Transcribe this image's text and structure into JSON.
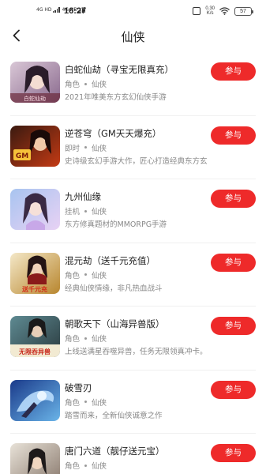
{
  "status_bar": {
    "signal1": "4G HD",
    "signal2": "4G HD",
    "time": "16:27",
    "net_speed_value": "0.30",
    "net_speed_unit": "K/s",
    "battery": "57"
  },
  "header": {
    "title": "仙侠",
    "back_icon": "chevron-left-icon"
  },
  "colors": {
    "accent": "#ee2a2a",
    "text_primary": "#222222",
    "text_secondary": "#888888"
  },
  "games": [
    {
      "name": "白蛇仙劫（寻宝无限真充）",
      "type": "角色",
      "genre": "仙侠",
      "desc": "2021年唯美东方玄幻仙侠手游",
      "button": "参与"
    },
    {
      "name": "逆苍穹（GM天天爆充）",
      "type": "即时",
      "genre": "仙侠",
      "desc": "史诗级玄幻手游大作，匠心打造经典东方玄幻世界！",
      "button": "参与"
    },
    {
      "name": "九州仙缘",
      "type": "挂机",
      "genre": "仙侠",
      "desc": "东方修真题材的MMORPG手游",
      "button": "参与"
    },
    {
      "name": "混元劫（送千元充值）",
      "type": "角色",
      "genre": "仙侠",
      "desc": "经典仙侠情缘，非凡热血战斗",
      "button": "参与"
    },
    {
      "name": "朝歌天下（山海异兽版）",
      "type": "角色",
      "genre": "仙侠",
      "desc": "上线送满星吞噬异兽，任务无限领真冲卡。",
      "button": "参与"
    },
    {
      "name": "破雪刃",
      "type": "角色",
      "genre": "仙侠",
      "desc": "踏雪而来，全新仙侠诚意之作",
      "button": "参与"
    },
    {
      "name": "唐门六道（靓仔送元宝）",
      "type": "角色",
      "genre": "仙侠",
      "desc": "",
      "button": "参与"
    }
  ]
}
